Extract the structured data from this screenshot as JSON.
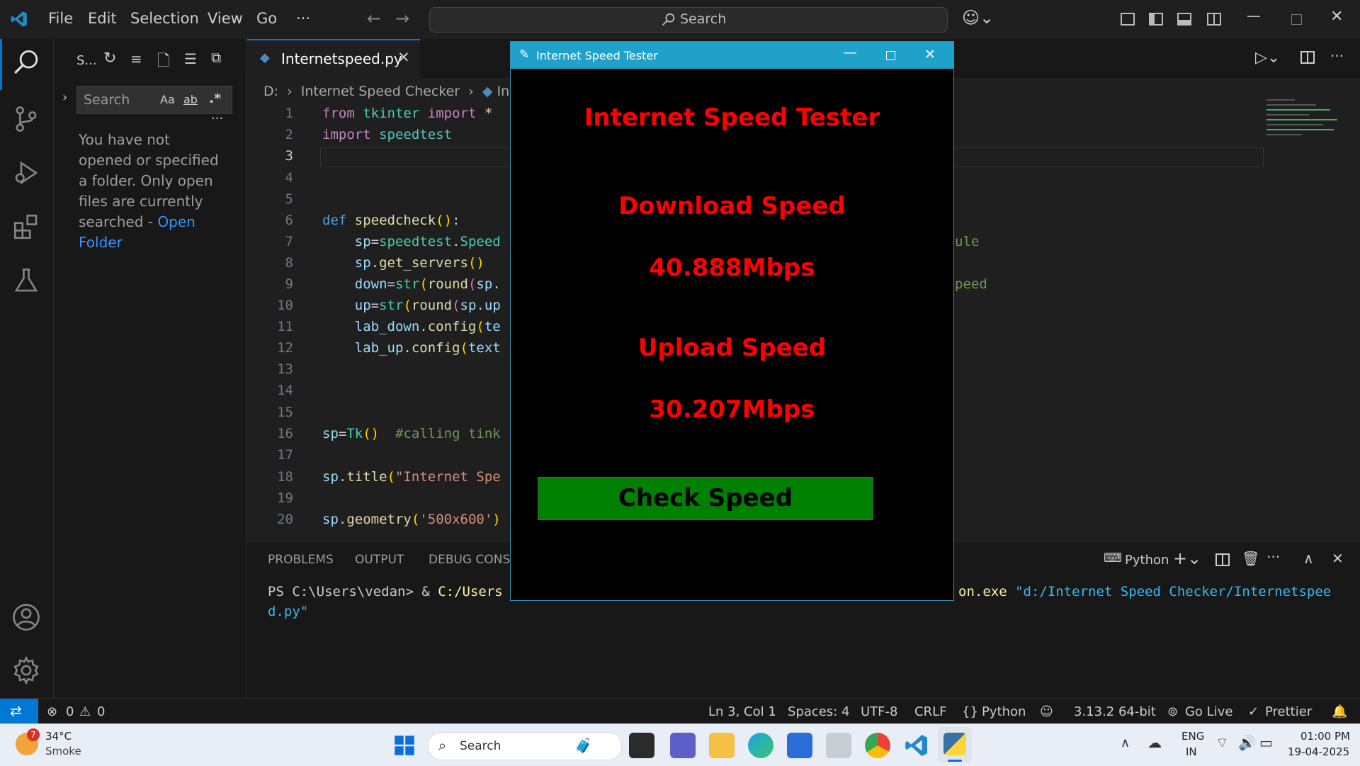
{
  "menu": [
    "File",
    "Edit",
    "Selection",
    "View",
    "Go",
    "···"
  ],
  "command_search": "Search",
  "sidebar": {
    "title": "S...",
    "search_placeholder": "Search",
    "opt_case": "Aa",
    "opt_word": "ab",
    "opt_regex": ".*",
    "message": "You have not opened or specified a folder. Only open files are currently searched -",
    "open_folder": "Open Folder"
  },
  "editor": {
    "tab_label": "Internetspeed.py",
    "breadcrumb": [
      "D:",
      "Internet Speed Checker",
      "Inte"
    ],
    "line_numbers": [
      "1",
      "2",
      "3",
      "4",
      "5",
      "6",
      "7",
      "8",
      "9",
      "10",
      "11",
      "12",
      "13",
      "14",
      "15",
      "16",
      "17",
      "18",
      "19",
      "20"
    ],
    "right_fragments": {
      "line7": "ule",
      "line9": "peed"
    }
  },
  "panel": {
    "tabs": [
      "PROBLEMS",
      "OUTPUT",
      "DEBUG CONSO"
    ],
    "terminal_label": "Python",
    "terminal_prompt": "PS C:\\Users\\vedan> & ",
    "terminal_cmd_part": "C:/Users",
    "terminal_exe": "on.exe",
    "terminal_arg": "\"d:/Internet Speed Checker/Internetspee",
    "terminal_arg_cont": "d.py\""
  },
  "status": {
    "errors": "0",
    "warnings": "0",
    "position": "Ln 3, Col 1",
    "spaces": "Spaces: 4",
    "encoding": "UTF-8",
    "eol": "CRLF",
    "language": "Python",
    "interpreter": "3.13.2 64-bit",
    "golive": "Go Live",
    "prettier": "Prettier"
  },
  "tk": {
    "window_title": "Internet Speed Tester",
    "heading": "Internet Speed Tester",
    "download_label": "Download Speed",
    "download_value": "40.888Mbps",
    "upload_label": "Upload Speed",
    "upload_value": "30.207Mbps",
    "button": "Check Speed"
  },
  "taskbar": {
    "weather_temp": "34°C",
    "weather_desc": "Smoke",
    "weather_badge": "7",
    "search": "Search",
    "lang1": "ENG",
    "lang2": "IN",
    "time": "01:00 PM",
    "date": "19-04-2025"
  },
  "colors": {
    "accent": "#0078d4",
    "tk_title": "#1fa2c9",
    "tk_text": "#ff0000",
    "tk_button": "#008000"
  }
}
